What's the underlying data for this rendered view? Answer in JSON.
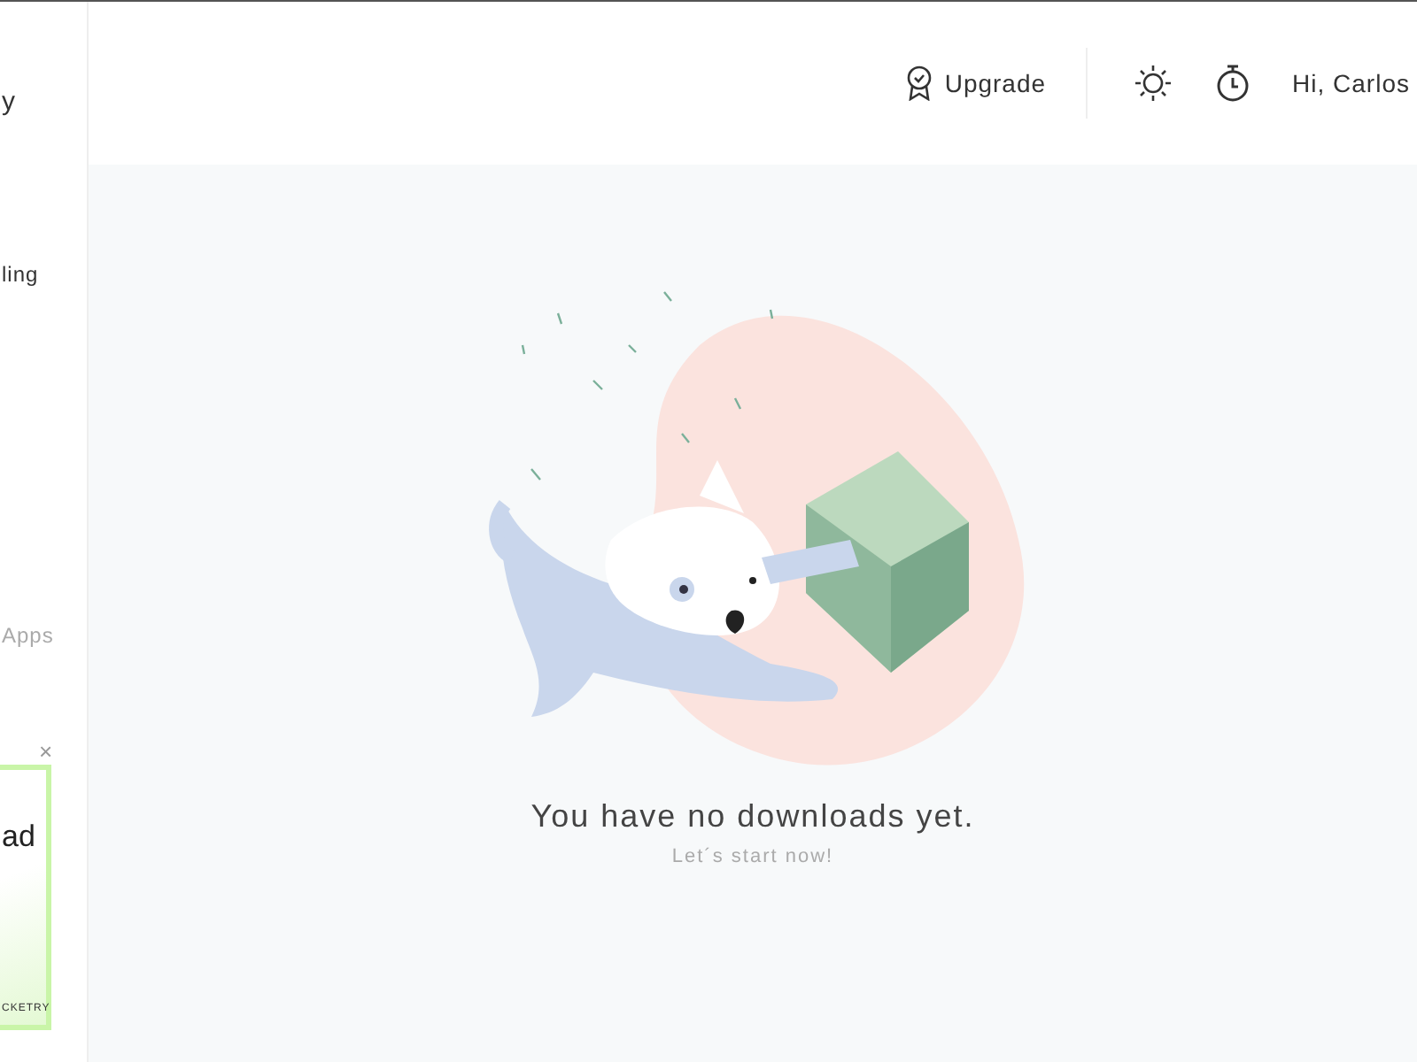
{
  "sidebar": {
    "logo_text": "y",
    "items": [
      {
        "label": "ling",
        "muted": false
      },
      {
        "label": "Apps",
        "muted": true
      }
    ],
    "ad": {
      "close": "×",
      "headline": "ad",
      "brand": "CKETRY"
    }
  },
  "header": {
    "upgrade": "Upgrade",
    "greeting": "Hi, Carlos"
  },
  "empty_state": {
    "title": "You have no downloads yet.",
    "subtitle": "Let´s start now!"
  }
}
